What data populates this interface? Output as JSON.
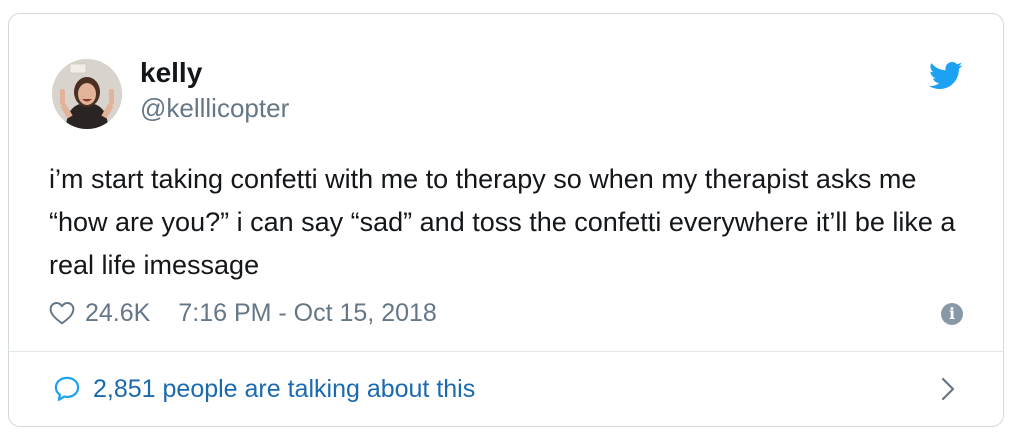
{
  "author": {
    "name": "kelly",
    "handle": "@kelllicopter"
  },
  "tweet": {
    "text": "i’m start taking confetti with me to therapy so when my therapist asks me “how are you?” i can say “sad” and toss the confetti everywhere it’ll be like a real life imessage",
    "likes": "24.6K",
    "timestamp": "7:16 PM - Oct 15, 2018"
  },
  "footer": {
    "talking_label": "2,851 people are talking about this"
  },
  "icons": {
    "logo": "twitter-bird-icon",
    "like": "heart-icon",
    "info": "info-icon",
    "reply": "speech-bubble-icon",
    "more": "chevron-right-icon"
  },
  "colors": {
    "brand": "#1da1f2",
    "link": "#1b6ab0",
    "secondary_text": "#657786",
    "border": "#cfd9de"
  }
}
